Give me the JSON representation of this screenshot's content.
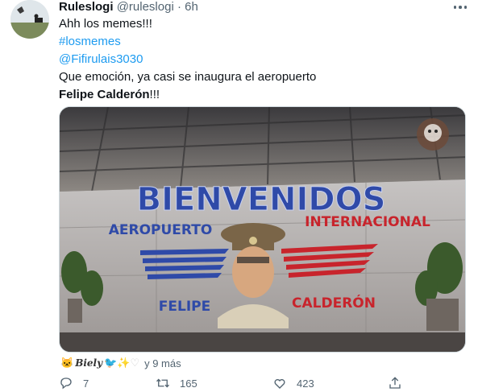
{
  "tweet": {
    "author_name": "Ruleslogi",
    "author_handle": "@ruleslogi",
    "separator": "·",
    "time": "6h",
    "lines": [
      "Ahh los memes!!!",
      "#losmemes",
      "@Fifirulais3030",
      "Que emoción, ya casi se inaugura el aeropuerto"
    ],
    "last_line_bold": "Felipe Calderón",
    "last_line_suffix": "!!!"
  },
  "image": {
    "sign_title": "BIENVENIDOS",
    "sign_left": "AEROPUERTO",
    "sign_right": "INTERNACIONAL",
    "sign_bottom_left": "FELIPE",
    "sign_bottom_right": "CALDERÓN"
  },
  "reactions": {
    "name": "Biely",
    "more_text": "y 9 más"
  },
  "actions": {
    "reply_count": "7",
    "retweet_count": "165",
    "like_count": "423"
  },
  "colors": {
    "link": "#1d9bf0",
    "muted": "#536471",
    "sign_blue": "#2f4aa8",
    "sign_red": "#c8242c"
  }
}
